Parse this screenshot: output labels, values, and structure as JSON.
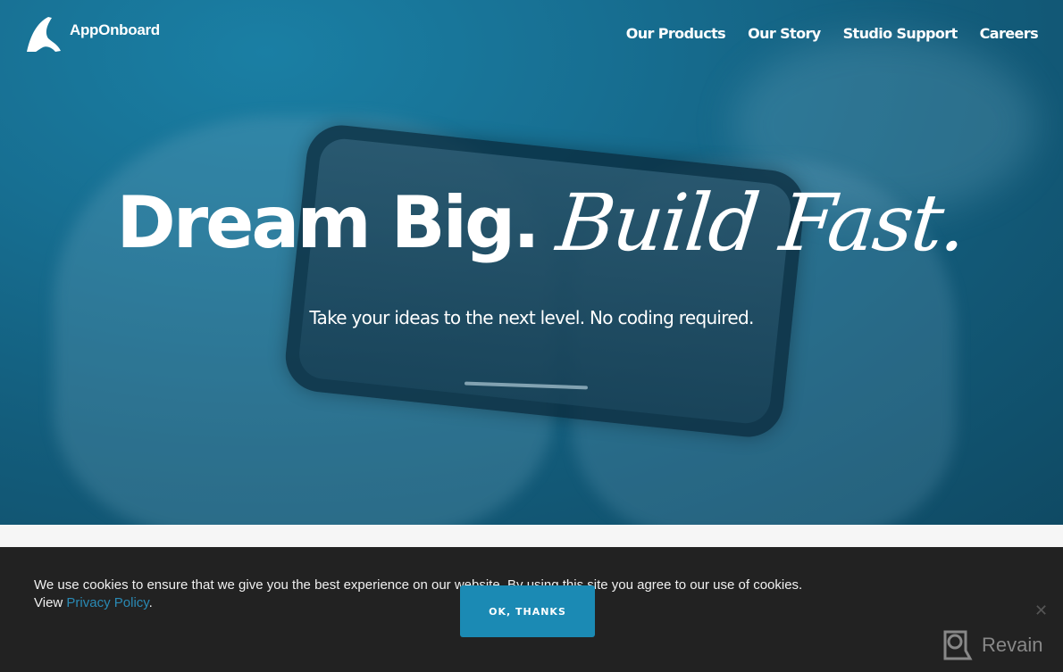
{
  "brand": {
    "name": "AppOnboard",
    "logo_icon": "appOnboard-arch-icon"
  },
  "nav": {
    "items": [
      {
        "label": "Our Products"
      },
      {
        "label": "Our Story"
      },
      {
        "label": "Studio Support"
      },
      {
        "label": "Careers"
      }
    ]
  },
  "hero": {
    "headline_bold": "Dream Big.",
    "headline_script": "Build Fast.",
    "subheadline": "Take your ideas to the next level. No coding required.",
    "background_color": "#176f92"
  },
  "cookie_banner": {
    "message": "We use cookies to ensure that we give you the best experience on our website. By using this site you agree to our use of cookies.",
    "view_prefix": "View",
    "privacy_link": "Privacy Policy",
    "suffix": ".",
    "accept_label": "OK, THANKS",
    "close_icon": "close-icon",
    "accent_color": "#1b8ab4"
  },
  "watermark": {
    "label": "Revain"
  }
}
